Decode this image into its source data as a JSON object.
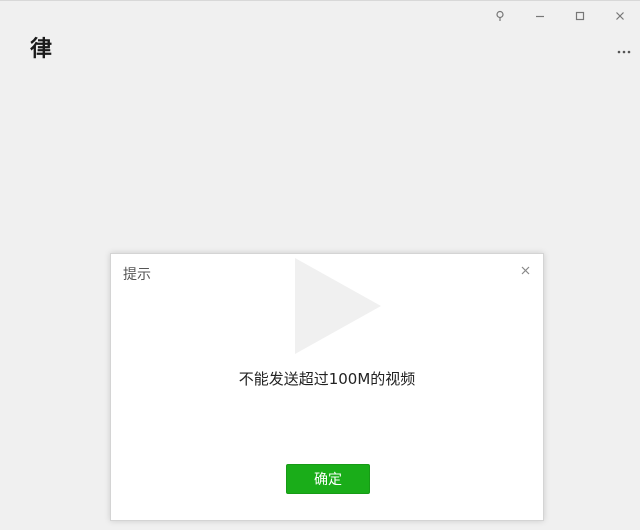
{
  "window": {
    "title": "律",
    "controls": {
      "pin_icon": "pin-icon",
      "minimize_icon": "minimize-icon",
      "maximize_icon": "maximize-icon",
      "close_icon": "close-icon",
      "more_icon": "more-icon"
    }
  },
  "dialog": {
    "title": "提示",
    "message": "不能发送超过100M的视频",
    "confirm_label": "确定",
    "close_icon": "close-icon"
  },
  "overlay": {
    "play_icon": "play-icon"
  },
  "colors": {
    "background": "#f0f0f0",
    "dialog_background": "#ffffff",
    "confirm_button": "#1aad19",
    "confirm_text": "#ffffff"
  }
}
